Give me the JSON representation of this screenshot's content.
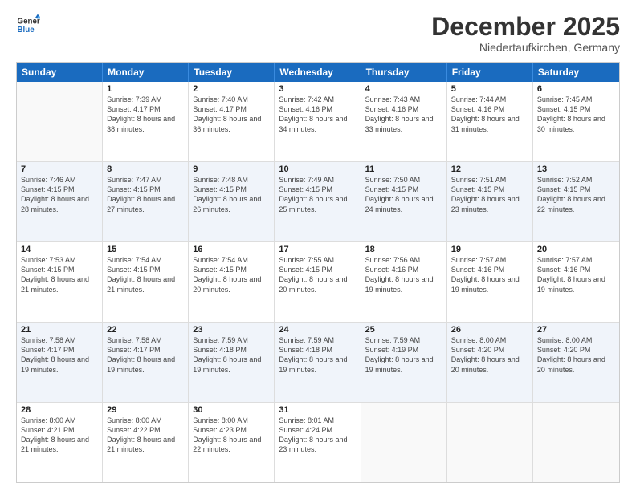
{
  "header": {
    "logo_line1": "General",
    "logo_line2": "Blue",
    "main_title": "December 2025",
    "subtitle": "Niedertaufkirchen, Germany"
  },
  "calendar": {
    "days_of_week": [
      "Sunday",
      "Monday",
      "Tuesday",
      "Wednesday",
      "Thursday",
      "Friday",
      "Saturday"
    ],
    "weeks": [
      [
        {
          "day": "",
          "sunrise": "",
          "sunset": "",
          "daylight": "",
          "empty": true
        },
        {
          "day": "1",
          "sunrise": "Sunrise: 7:39 AM",
          "sunset": "Sunset: 4:17 PM",
          "daylight": "Daylight: 8 hours and 38 minutes."
        },
        {
          "day": "2",
          "sunrise": "Sunrise: 7:40 AM",
          "sunset": "Sunset: 4:17 PM",
          "daylight": "Daylight: 8 hours and 36 minutes."
        },
        {
          "day": "3",
          "sunrise": "Sunrise: 7:42 AM",
          "sunset": "Sunset: 4:16 PM",
          "daylight": "Daylight: 8 hours and 34 minutes."
        },
        {
          "day": "4",
          "sunrise": "Sunrise: 7:43 AM",
          "sunset": "Sunset: 4:16 PM",
          "daylight": "Daylight: 8 hours and 33 minutes."
        },
        {
          "day": "5",
          "sunrise": "Sunrise: 7:44 AM",
          "sunset": "Sunset: 4:16 PM",
          "daylight": "Daylight: 8 hours and 31 minutes."
        },
        {
          "day": "6",
          "sunrise": "Sunrise: 7:45 AM",
          "sunset": "Sunset: 4:15 PM",
          "daylight": "Daylight: 8 hours and 30 minutes."
        }
      ],
      [
        {
          "day": "7",
          "sunrise": "Sunrise: 7:46 AM",
          "sunset": "Sunset: 4:15 PM",
          "daylight": "Daylight: 8 hours and 28 minutes."
        },
        {
          "day": "8",
          "sunrise": "Sunrise: 7:47 AM",
          "sunset": "Sunset: 4:15 PM",
          "daylight": "Daylight: 8 hours and 27 minutes."
        },
        {
          "day": "9",
          "sunrise": "Sunrise: 7:48 AM",
          "sunset": "Sunset: 4:15 PM",
          "daylight": "Daylight: 8 hours and 26 minutes."
        },
        {
          "day": "10",
          "sunrise": "Sunrise: 7:49 AM",
          "sunset": "Sunset: 4:15 PM",
          "daylight": "Daylight: 8 hours and 25 minutes."
        },
        {
          "day": "11",
          "sunrise": "Sunrise: 7:50 AM",
          "sunset": "Sunset: 4:15 PM",
          "daylight": "Daylight: 8 hours and 24 minutes."
        },
        {
          "day": "12",
          "sunrise": "Sunrise: 7:51 AM",
          "sunset": "Sunset: 4:15 PM",
          "daylight": "Daylight: 8 hours and 23 minutes."
        },
        {
          "day": "13",
          "sunrise": "Sunrise: 7:52 AM",
          "sunset": "Sunset: 4:15 PM",
          "daylight": "Daylight: 8 hours and 22 minutes."
        }
      ],
      [
        {
          "day": "14",
          "sunrise": "Sunrise: 7:53 AM",
          "sunset": "Sunset: 4:15 PM",
          "daylight": "Daylight: 8 hours and 21 minutes."
        },
        {
          "day": "15",
          "sunrise": "Sunrise: 7:54 AM",
          "sunset": "Sunset: 4:15 PM",
          "daylight": "Daylight: 8 hours and 21 minutes."
        },
        {
          "day": "16",
          "sunrise": "Sunrise: 7:54 AM",
          "sunset": "Sunset: 4:15 PM",
          "daylight": "Daylight: 8 hours and 20 minutes."
        },
        {
          "day": "17",
          "sunrise": "Sunrise: 7:55 AM",
          "sunset": "Sunset: 4:15 PM",
          "daylight": "Daylight: 8 hours and 20 minutes."
        },
        {
          "day": "18",
          "sunrise": "Sunrise: 7:56 AM",
          "sunset": "Sunset: 4:16 PM",
          "daylight": "Daylight: 8 hours and 19 minutes."
        },
        {
          "day": "19",
          "sunrise": "Sunrise: 7:57 AM",
          "sunset": "Sunset: 4:16 PM",
          "daylight": "Daylight: 8 hours and 19 minutes."
        },
        {
          "day": "20",
          "sunrise": "Sunrise: 7:57 AM",
          "sunset": "Sunset: 4:16 PM",
          "daylight": "Daylight: 8 hours and 19 minutes."
        }
      ],
      [
        {
          "day": "21",
          "sunrise": "Sunrise: 7:58 AM",
          "sunset": "Sunset: 4:17 PM",
          "daylight": "Daylight: 8 hours and 19 minutes."
        },
        {
          "day": "22",
          "sunrise": "Sunrise: 7:58 AM",
          "sunset": "Sunset: 4:17 PM",
          "daylight": "Daylight: 8 hours and 19 minutes."
        },
        {
          "day": "23",
          "sunrise": "Sunrise: 7:59 AM",
          "sunset": "Sunset: 4:18 PM",
          "daylight": "Daylight: 8 hours and 19 minutes."
        },
        {
          "day": "24",
          "sunrise": "Sunrise: 7:59 AM",
          "sunset": "Sunset: 4:18 PM",
          "daylight": "Daylight: 8 hours and 19 minutes."
        },
        {
          "day": "25",
          "sunrise": "Sunrise: 7:59 AM",
          "sunset": "Sunset: 4:19 PM",
          "daylight": "Daylight: 8 hours and 19 minutes."
        },
        {
          "day": "26",
          "sunrise": "Sunrise: 8:00 AM",
          "sunset": "Sunset: 4:20 PM",
          "daylight": "Daylight: 8 hours and 20 minutes."
        },
        {
          "day": "27",
          "sunrise": "Sunrise: 8:00 AM",
          "sunset": "Sunset: 4:20 PM",
          "daylight": "Daylight: 8 hours and 20 minutes."
        }
      ],
      [
        {
          "day": "28",
          "sunrise": "Sunrise: 8:00 AM",
          "sunset": "Sunset: 4:21 PM",
          "daylight": "Daylight: 8 hours and 21 minutes."
        },
        {
          "day": "29",
          "sunrise": "Sunrise: 8:00 AM",
          "sunset": "Sunset: 4:22 PM",
          "daylight": "Daylight: 8 hours and 21 minutes."
        },
        {
          "day": "30",
          "sunrise": "Sunrise: 8:00 AM",
          "sunset": "Sunset: 4:23 PM",
          "daylight": "Daylight: 8 hours and 22 minutes."
        },
        {
          "day": "31",
          "sunrise": "Sunrise: 8:01 AM",
          "sunset": "Sunset: 4:24 PM",
          "daylight": "Daylight: 8 hours and 23 minutes."
        },
        {
          "day": "",
          "sunrise": "",
          "sunset": "",
          "daylight": "",
          "empty": true
        },
        {
          "day": "",
          "sunrise": "",
          "sunset": "",
          "daylight": "",
          "empty": true
        },
        {
          "day": "",
          "sunrise": "",
          "sunset": "",
          "daylight": "",
          "empty": true
        }
      ]
    ]
  }
}
